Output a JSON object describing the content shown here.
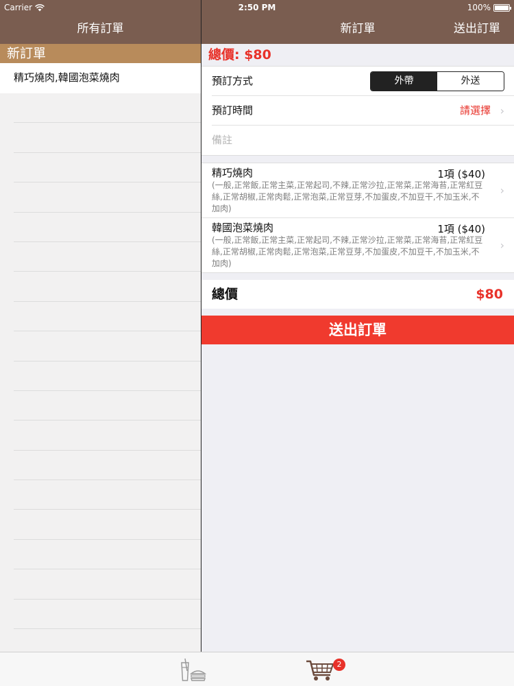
{
  "status_bar": {
    "carrier": "Carrier",
    "time": "2:50 PM",
    "battery": "100%"
  },
  "left_pane": {
    "nav_title": "所有訂單",
    "section_header": "新訂單",
    "orders": [
      {
        "label": "精巧燒肉,韓國泡菜燒肉"
      }
    ]
  },
  "right_pane": {
    "nav_title": "新訂單",
    "nav_action": "送出訂單",
    "total_banner": "總價: $80",
    "form": {
      "method_label": "預訂方式",
      "method_options": [
        "外帶",
        "外送"
      ],
      "method_selected": "外帶",
      "time_label": "預訂時間",
      "time_value": "請選擇",
      "note_placeholder": "備註"
    },
    "items": [
      {
        "name": "精巧燒肉",
        "qty": "1項 ($40)",
        "detail": "(一般,正常飯,正常主菜,正常起司,不辣,正常沙拉,正常菜,正常海苔,正常紅豆絲,正常胡椒,正常肉鬆,正常泡菜,正常豆芽,不加蛋皮,不加豆干,不加玉米,不加肉)"
      },
      {
        "name": "韓國泡菜燒肉",
        "qty": "1項 ($40)",
        "detail": "(一般,正常飯,正常主菜,正常起司,不辣,正常沙拉,正常菜,正常海苔,正常紅豆絲,正常胡椒,正常肉鬆,正常泡菜,正常豆芽,不加蛋皮,不加豆干,不加玉米,不加肉)"
      }
    ],
    "sum_label": "總價",
    "sum_value": "$80",
    "submit_button": "送出訂單"
  },
  "tab_bar": {
    "tabs": [
      {
        "icon": "drinks-icon"
      },
      {
        "icon": "cart-icon",
        "badge": "2"
      }
    ]
  },
  "colors": {
    "nav_bar": "#7a5d50",
    "section_header": "#b88b5b",
    "accent_red": "#e8322a",
    "submit_button": "#f03a2e"
  }
}
